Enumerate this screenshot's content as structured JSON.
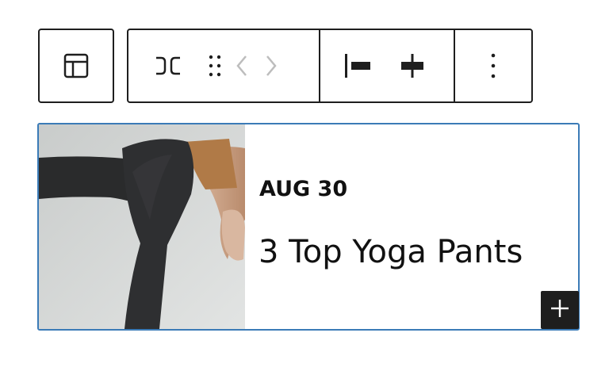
{
  "toolbar": {
    "parent_block_icon": "layout-template-icon",
    "transform_icon": "query-loop-transform-icon",
    "drag_icon": "drag-handle-icon",
    "move_left_icon": "chevron-left-icon",
    "move_right_icon": "chevron-right-icon",
    "justify_left_icon": "justify-left-icon",
    "justify_center_icon": "justify-center-icon",
    "options_icon": "more-vertical-icon"
  },
  "post": {
    "date": "AUG 30",
    "title": "3 Top Yoga Pants",
    "image_icon": "yoga-photo"
  },
  "inserter": {
    "icon": "plus-icon"
  },
  "colors": {
    "toolbar_border": "#1e1e1e",
    "block_selected_border": "#3b7bb7",
    "inserter_bg": "#1e1e1e"
  }
}
